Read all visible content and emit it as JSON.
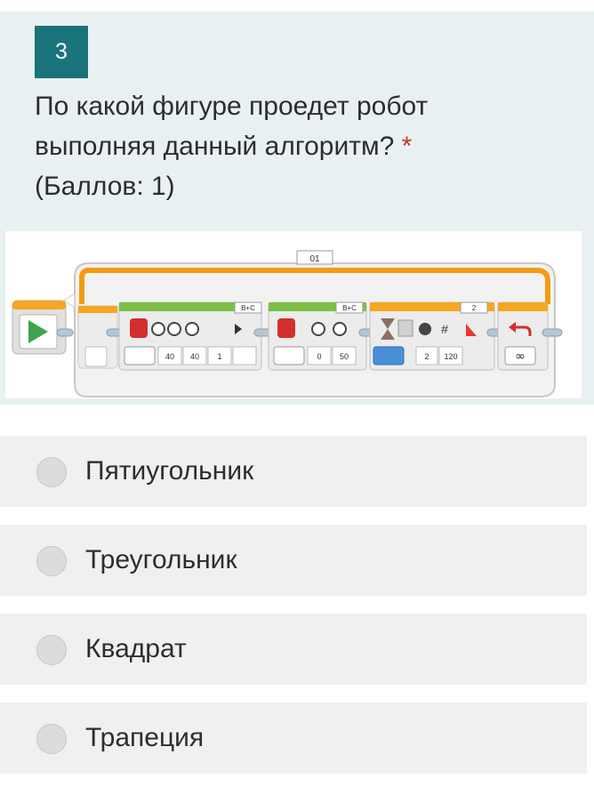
{
  "question": {
    "number": "3",
    "text_line1": "По какой фигуре проедет робот",
    "text_line2": "выполняя данный алгоритм?",
    "required_mark": "*",
    "points": "(Баллов: 1)"
  },
  "program": {
    "loop_name": "01",
    "move_tank_ports": "B+C",
    "move_tank_values": [
      "40",
      "40",
      "1"
    ],
    "move_steering_ports": "B+C",
    "move_steering_values": [
      "0",
      "50"
    ],
    "wait_port": "2",
    "wait_values": [
      "2",
      "120"
    ],
    "loop_symbol": "∞"
  },
  "options": [
    {
      "label": "Пятиугольник"
    },
    {
      "label": "Треугольник"
    },
    {
      "label": "Квадрат"
    },
    {
      "label": "Трапеция"
    }
  ],
  "colors": {
    "number_badge": "#18747a",
    "card_bg": "#e9f0f2",
    "required": "#c0392b",
    "loop_orange": "#f39c12",
    "block_green": "#7bc043",
    "block_orange": "#f5a623"
  }
}
